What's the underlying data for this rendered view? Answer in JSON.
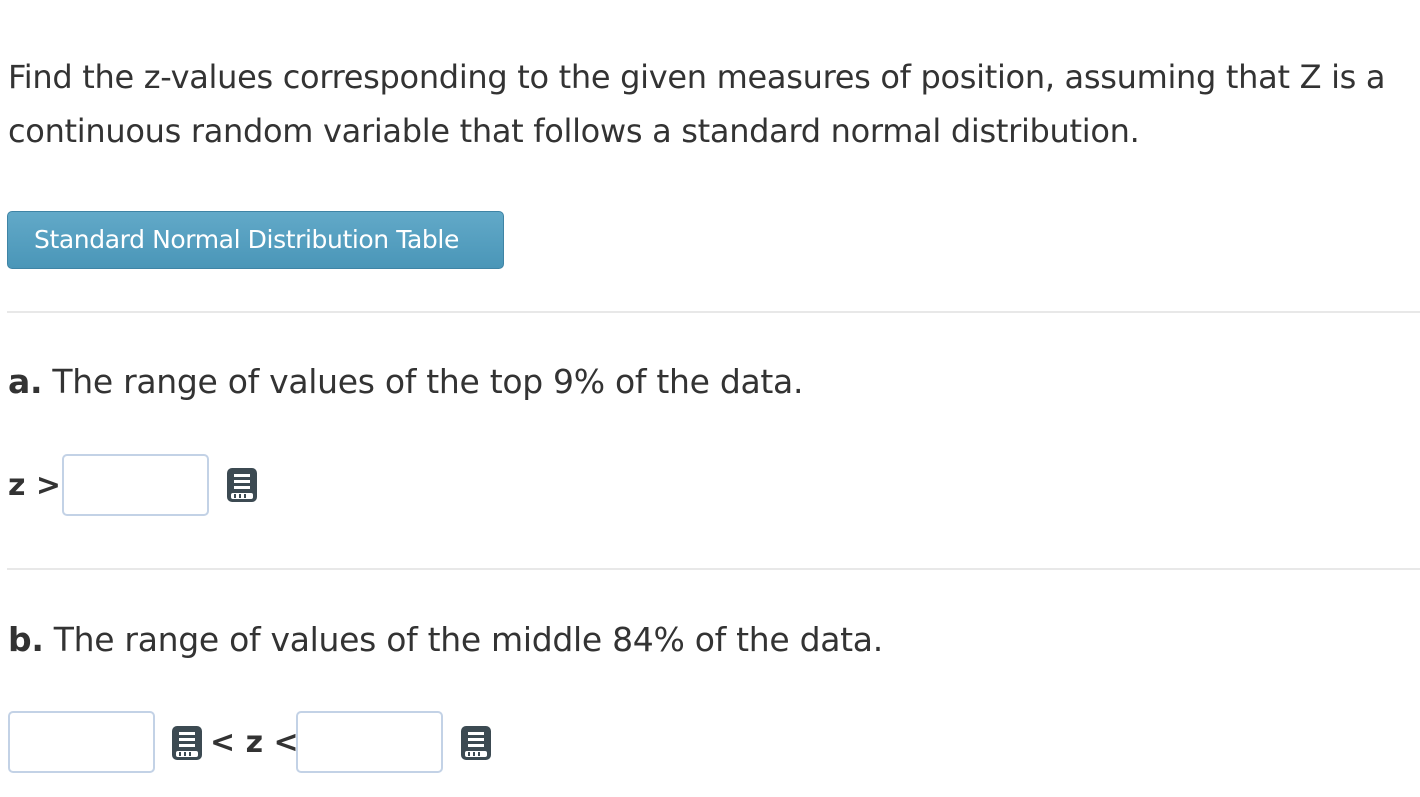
{
  "intro_text": "Find the z-values corresponding to the given measures of position, assuming that Z is a continuous random variable that follows a standard normal distribution.",
  "table_button_label": "Standard Normal Distribution Table",
  "part_a": {
    "prefix": "a.",
    "text": "The range of values of the top 9% of the data.",
    "label": "z >",
    "value": ""
  },
  "part_b": {
    "prefix": "b.",
    "text": "The range of values of the middle 84% of the data.",
    "lower_value": "",
    "middle_label": "< z <",
    "upper_value": ""
  },
  "icons": {
    "answer_tool": "calculator-book-icon"
  },
  "colors": {
    "button_background": "#529dbe",
    "input_border": "#c3d2e6",
    "icon": "#3c4a52",
    "text": "#333333"
  }
}
